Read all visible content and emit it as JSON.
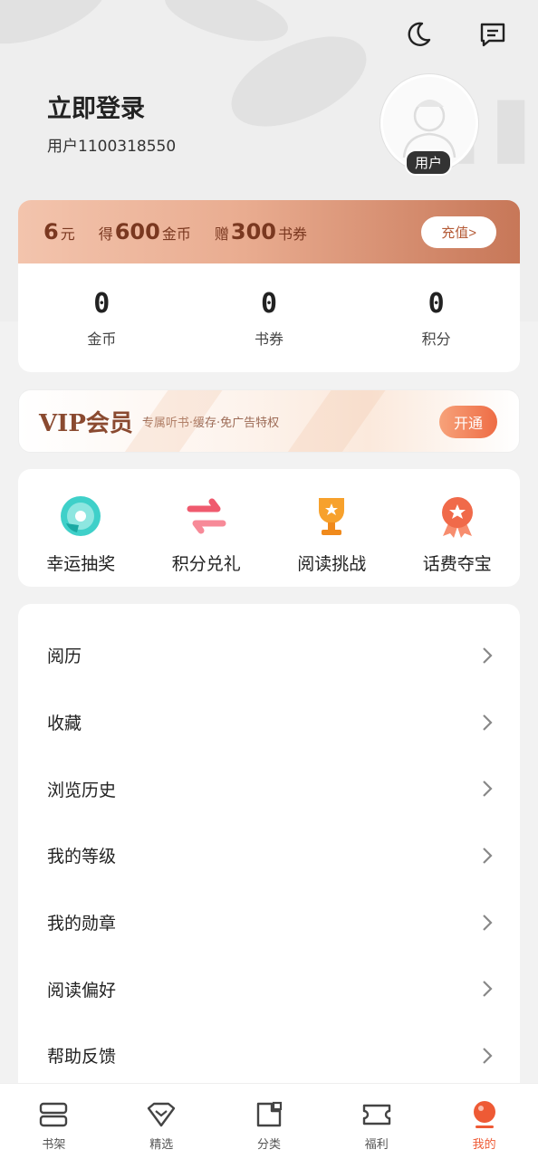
{
  "header": {
    "title": "立即登录",
    "user_id": "用户1100318550",
    "avatar_badge": "用户"
  },
  "recharge": {
    "price_num": "6",
    "price_unit": "元",
    "gain_prefix": "得",
    "gain_num": "600",
    "gain_unit": "金币",
    "gift_prefix": "赠",
    "gift_num": "300",
    "gift_unit": "书券",
    "button": "充值>"
  },
  "stats": [
    {
      "value": "0",
      "label": "金币"
    },
    {
      "value": "0",
      "label": "书券"
    },
    {
      "value": "0",
      "label": "积分"
    }
  ],
  "vip": {
    "title": "VIP会员",
    "subtitle": "专属听书·缓存·免广告特权",
    "button": "开通"
  },
  "actions": [
    {
      "label": "幸运抽奖",
      "icon": "disc-icon"
    },
    {
      "label": "积分兑礼",
      "icon": "exchange-icon"
    },
    {
      "label": "阅读挑战",
      "icon": "trophy-icon"
    },
    {
      "label": "话费夺宝",
      "icon": "medal-icon"
    }
  ],
  "menu": [
    {
      "label": "阅历"
    },
    {
      "label": "收藏"
    },
    {
      "label": "浏览历史"
    },
    {
      "label": "我的等级"
    },
    {
      "label": "我的勋章"
    },
    {
      "label": "阅读偏好"
    },
    {
      "label": "帮助反馈"
    }
  ],
  "nav": [
    {
      "label": "书架",
      "icon": "bookshelf-icon"
    },
    {
      "label": "精选",
      "icon": "diamond-icon"
    },
    {
      "label": "分类",
      "icon": "category-icon"
    },
    {
      "label": "福利",
      "icon": "ticket-icon"
    },
    {
      "label": "我的",
      "icon": "profile-icon",
      "active": true
    }
  ],
  "colors": {
    "accent": "#ee5a35",
    "recharge_text": "#7a3820",
    "vip_text": "#8a4a30"
  }
}
